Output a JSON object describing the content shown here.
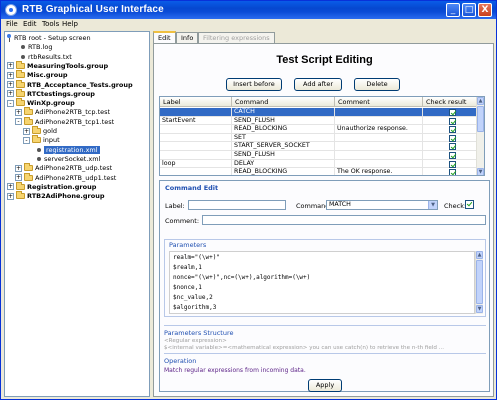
{
  "window": {
    "title": "RTB Graphical User Interface",
    "minimize_label": "_",
    "maximize_label": "□",
    "close_label": "X"
  },
  "menu": [
    "File",
    "Edit",
    "Tools",
    "Help"
  ],
  "tree": {
    "expand_plus": "+",
    "expand_minus": "-",
    "items": [
      {
        "label": "RTB root - Setup screen",
        "depth": 0,
        "icon": "root-pin-icon"
      },
      {
        "label": "RTB.log",
        "depth": 1,
        "icon": "file-dot-icon"
      },
      {
        "label": "rtbResults.txt",
        "depth": 1,
        "icon": "file-dot-icon"
      },
      {
        "label": "MeasuringTools.group",
        "depth": 0,
        "icon": "folder-icon",
        "bold": true,
        "expander": "+"
      },
      {
        "label": "Misc.group",
        "depth": 0,
        "icon": "folder-icon",
        "bold": true,
        "expander": "+"
      },
      {
        "label": "RTB_Acceptance_Tests.group",
        "depth": 0,
        "icon": "folder-icon",
        "bold": true,
        "expander": "+"
      },
      {
        "label": "RTCtestings.group",
        "depth": 0,
        "icon": "folder-icon",
        "bold": true,
        "expander": "+"
      },
      {
        "label": "WinXp.group",
        "depth": 0,
        "icon": "folder-icon",
        "bold": true,
        "expander": "-"
      },
      {
        "label": "AdiPhone2RTB_tcp.test",
        "depth": 1,
        "icon": "folder-icon",
        "expander": "+"
      },
      {
        "label": "AdiPhone2RTB_tcp1.test",
        "depth": 1,
        "icon": "folder-icon",
        "expander": "-"
      },
      {
        "label": "gold",
        "depth": 2,
        "icon": "folder-icon",
        "expander": "+"
      },
      {
        "label": "input",
        "depth": 2,
        "icon": "folder-icon",
        "expander": "-"
      },
      {
        "label": "registration.xml",
        "depth": 3,
        "icon": "file-dot-icon",
        "selected": true
      },
      {
        "label": "serverSocket.xml",
        "depth": 3,
        "icon": "file-dot-icon"
      },
      {
        "label": "AdiPhone2RTB_udp.test",
        "depth": 1,
        "icon": "folder-icon",
        "expander": "+"
      },
      {
        "label": "AdiPhone2RTB_udp1.test",
        "depth": 1,
        "icon": "folder-icon",
        "expander": "+"
      },
      {
        "label": "Registration.group",
        "depth": 0,
        "icon": "folder-icon",
        "bold": true,
        "expander": "+"
      },
      {
        "label": "RTB2AdiPhone.group",
        "depth": 0,
        "icon": "folder-icon",
        "bold": true,
        "expander": "+"
      }
    ]
  },
  "tabs": [
    {
      "label": "Edit",
      "active": true
    },
    {
      "label": "Info",
      "active": false
    },
    {
      "label": "Filtering expressions",
      "disabled": true
    }
  ],
  "editor": {
    "heading": "Test Script Editing",
    "buttons": {
      "insert_before": "Insert before",
      "add_after": "Add after",
      "delete": "Delete"
    },
    "table": {
      "columns": [
        "Label",
        "Command",
        "Comment",
        "Check result"
      ],
      "rows": [
        {
          "label": "",
          "command": "CATCH",
          "comment": "",
          "checked": true,
          "selected": true
        },
        {
          "label": "StartEvent",
          "command": "SEND_FLUSH",
          "comment": "",
          "checked": true
        },
        {
          "label": "",
          "command": "READ_BLOCKING",
          "comment": "Unauthorize response.",
          "checked": true
        },
        {
          "label": "",
          "command": "SET",
          "comment": "",
          "checked": true
        },
        {
          "label": "",
          "command": "START_SERVER_SOCKET",
          "comment": "",
          "checked": true
        },
        {
          "label": "",
          "command": "SEND_FLUSH",
          "comment": "",
          "checked": true
        },
        {
          "label": "loop",
          "command": "DELAY",
          "comment": "",
          "checked": true
        },
        {
          "label": "",
          "command": "READ_BLOCKING",
          "comment": "The OK response.",
          "checked": true
        }
      ]
    },
    "command_edit": {
      "title": "Command Edit",
      "label_label": "Label:",
      "label_value": "",
      "command_label": "Command:",
      "command_value": "MATCH",
      "check_label": "Check:",
      "check_value": true,
      "comment_label": "Comment:",
      "comment_value": "",
      "parameters_title": "Parameters",
      "parameters": [
        "realm=\"(\\w+)\"",
        "$realm,1",
        "nonce=\"(\\w+)\",nc=(\\w+),algorithm=(\\w+)",
        "$nonce,1",
        "$nc_value,2",
        "$algorithm,3"
      ],
      "structure_title": "Parameters Structure",
      "structure_lines": [
        "<Regular expression>",
        "$<internal variable>=<mathematical expression> you can use catch(n) to retrieve the n-th field ..."
      ],
      "operation_title": "Operation",
      "operation_text": "Match regular expressions from incoming data.",
      "apply_label": "Apply"
    }
  }
}
